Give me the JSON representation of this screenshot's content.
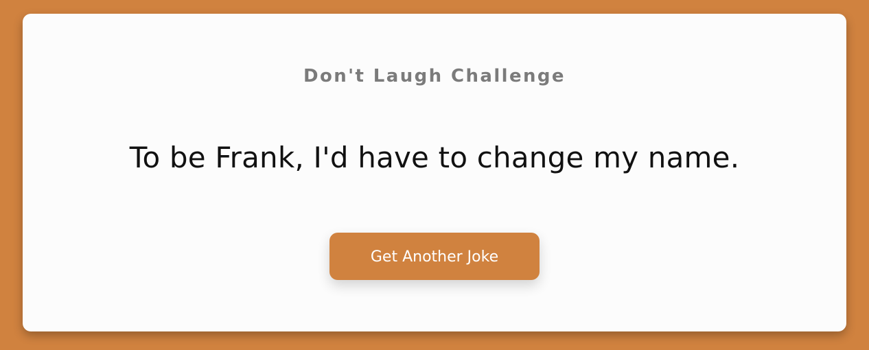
{
  "card": {
    "header": "Don't Laugh Challenge",
    "joke": "To be Frank, I'd have to change my name.",
    "button_label": "Get Another Joke"
  },
  "colors": {
    "background": "#d0823f",
    "card": "#fcfcfc",
    "header_text": "#7b7b7b",
    "joke_text": "#111111",
    "button": "#d0823f",
    "button_text": "#ffffff"
  }
}
